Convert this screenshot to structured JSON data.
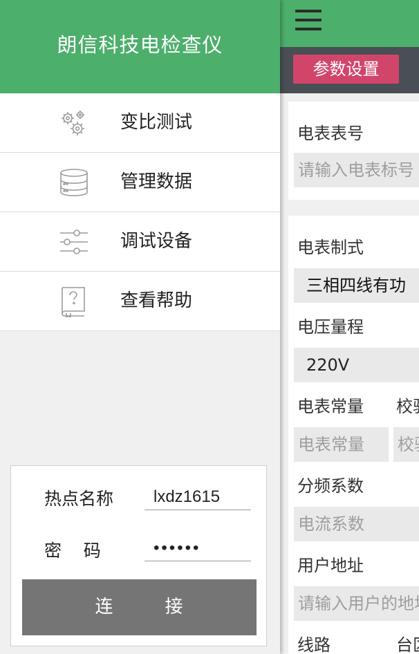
{
  "drawer": {
    "title": "朗信科技电检查仪",
    "menu": [
      {
        "label": "变比测试",
        "icon": "gears-icon"
      },
      {
        "label": "管理数据",
        "icon": "database-icon"
      },
      {
        "label": "调试设备",
        "icon": "sliders-icon"
      },
      {
        "label": "查看帮助",
        "icon": "help-book-icon"
      }
    ],
    "wifi": {
      "ssid_label": "热点名称",
      "ssid_value": "lxdz1615",
      "password_label": "密    码",
      "password_value": "••••••",
      "connect_label": "连        接"
    }
  },
  "main": {
    "tab_active": "参数设置",
    "fields": {
      "meter_no_label": "电表表号",
      "meter_no_placeholder": "请输入电表标号",
      "meter_type_label": "电表制式",
      "meter_type_value": "三相四线有功",
      "voltage_label": "电压量程",
      "voltage_value": "220V",
      "meter_const_label": "电表常量",
      "verify_label": "校验",
      "meter_const_placeholder": "电表常量",
      "verify_placeholder": "校验",
      "divider_label": "分频系数",
      "current_coef_placeholder": "电流系数",
      "user_addr_label": "用户地址",
      "user_addr_placeholder": "请输入用户的地址",
      "line_label": "线路",
      "station_label": "台区"
    }
  },
  "colors": {
    "header_green": "#4caf6b",
    "tab_pink": "#d2456b",
    "tab_bar": "#4a4f55",
    "connect_button": "#757575"
  }
}
